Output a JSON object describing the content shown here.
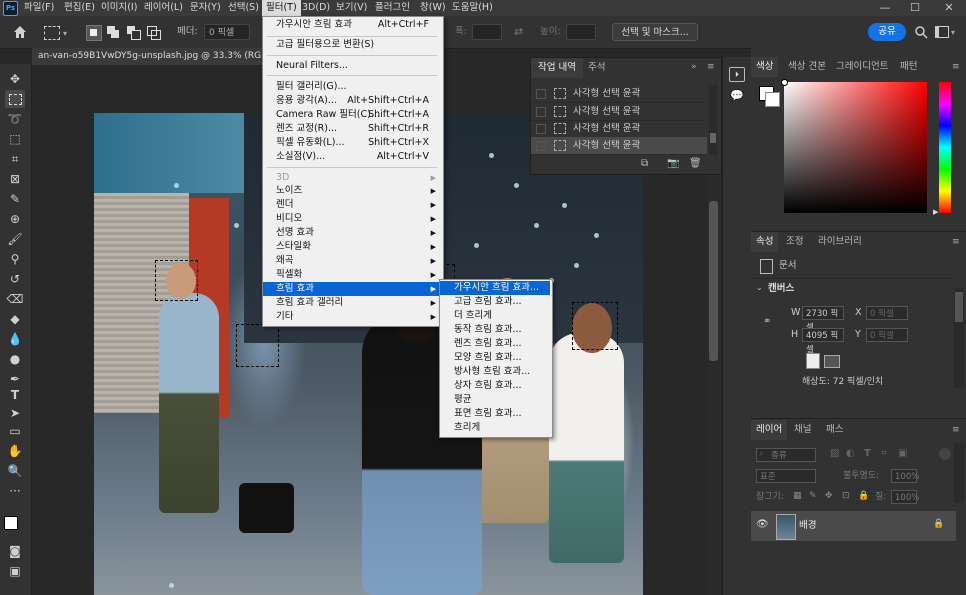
{
  "menubar": {
    "logo": "Ps",
    "items": [
      "파일(F)",
      "편집(E)",
      "이미지(I)",
      "레이어(L)",
      "문자(Y)",
      "선택(S)",
      "필터(T)",
      "3D(D)",
      "보기(V)",
      "플러그인",
      "창(W)",
      "도움말(H)"
    ],
    "window_controls": [
      "—",
      "☐",
      "✕"
    ]
  },
  "optionsbar": {
    "feather_label": "페더:",
    "feather_value": "0 픽셀",
    "width_label": "폭:",
    "height_label": "높이:",
    "select_mask_button": "선택 및 마스크...",
    "share_button": "공유"
  },
  "document": {
    "tab_title": "an-van-o59B1VwDY5g-unsplash.jpg @ 33.3% (RGB/8) *"
  },
  "filter_menu": {
    "items": [
      {
        "label": "가우시안 흐림 효과",
        "shortcut": "Alt+Ctrl+F"
      },
      {
        "label": "고급 필터용으로 변환(S)",
        "shortcut": ""
      },
      {
        "label": "Neural Filters...",
        "shortcut": ""
      },
      {
        "label": "필터 갤러리(G)...",
        "shortcut": ""
      },
      {
        "label": "응용 광각(A)...",
        "shortcut": "Alt+Shift+Ctrl+A"
      },
      {
        "label": "Camera Raw 필터(C)...",
        "shortcut": "Shift+Ctrl+A"
      },
      {
        "label": "렌즈 교정(R)...",
        "shortcut": "Shift+Ctrl+R"
      },
      {
        "label": "픽셀 유동화(L)...",
        "shortcut": "Shift+Ctrl+X"
      },
      {
        "label": "소실점(V)...",
        "shortcut": "Alt+Ctrl+V"
      },
      {
        "label": "3D",
        "submenu": true,
        "disabled": true
      },
      {
        "label": "노이즈",
        "submenu": true
      },
      {
        "label": "렌더",
        "submenu": true
      },
      {
        "label": "비디오",
        "submenu": true
      },
      {
        "label": "선명 효과",
        "submenu": true
      },
      {
        "label": "스타일화",
        "submenu": true
      },
      {
        "label": "왜곡",
        "submenu": true
      },
      {
        "label": "픽셀화",
        "submenu": true
      },
      {
        "label": "흐림 효과",
        "submenu": true,
        "highlighted": true
      },
      {
        "label": "흐림 효과 갤러리",
        "submenu": true
      },
      {
        "label": "기타",
        "submenu": true
      }
    ]
  },
  "blur_submenu": {
    "items": [
      "가우시안 흐림 효과...",
      "고급 흐림 효과...",
      "더 흐리게",
      "동작 흐림 효과...",
      "렌즈 흐림 효과...",
      "모양 흐림 효과...",
      "방사형 흐림 효과...",
      "상자 흐림 효과...",
      "평균",
      "표면 흐림 효과...",
      "흐리게"
    ]
  },
  "history_panel": {
    "tabs": [
      "작업 내역",
      "주석"
    ],
    "rows": [
      "사각형 선택 윤곽",
      "사각형 선택 윤곽",
      "사각형 선택 윤곽",
      "사각형 선택 윤곽"
    ]
  },
  "color_panel": {
    "tabs": [
      "색상",
      "색상 견본",
      "그레이디언트",
      "패턴"
    ],
    "hue_color": "#ff0000"
  },
  "properties_panel": {
    "tabs": [
      "속성",
      "조정",
      "라이브러리"
    ],
    "doc_label": "문서",
    "canvas_header": "캔버스",
    "w_label": "W",
    "w_value": "2730 픽셀",
    "h_label": "H",
    "h_value": "4095 픽셀",
    "x_label": "X",
    "x_placeholder": "0 픽셀",
    "y_label": "Y",
    "y_placeholder": "0 픽셀",
    "resolution": "해상도: 72 픽셀/인치"
  },
  "layers_panel": {
    "tabs": [
      "레이어",
      "채널",
      "패스"
    ],
    "filter_value": "종류",
    "blend_mode": "표준",
    "opacity_label": "불투명도:",
    "opacity_value": "100%",
    "lock_label": "잠그기:",
    "fill_label": "칠:",
    "fill_value": "100%",
    "layer_name": "배경"
  },
  "colors": {
    "accent": "#1473e6",
    "menu_highlight": "#0a64d2"
  }
}
